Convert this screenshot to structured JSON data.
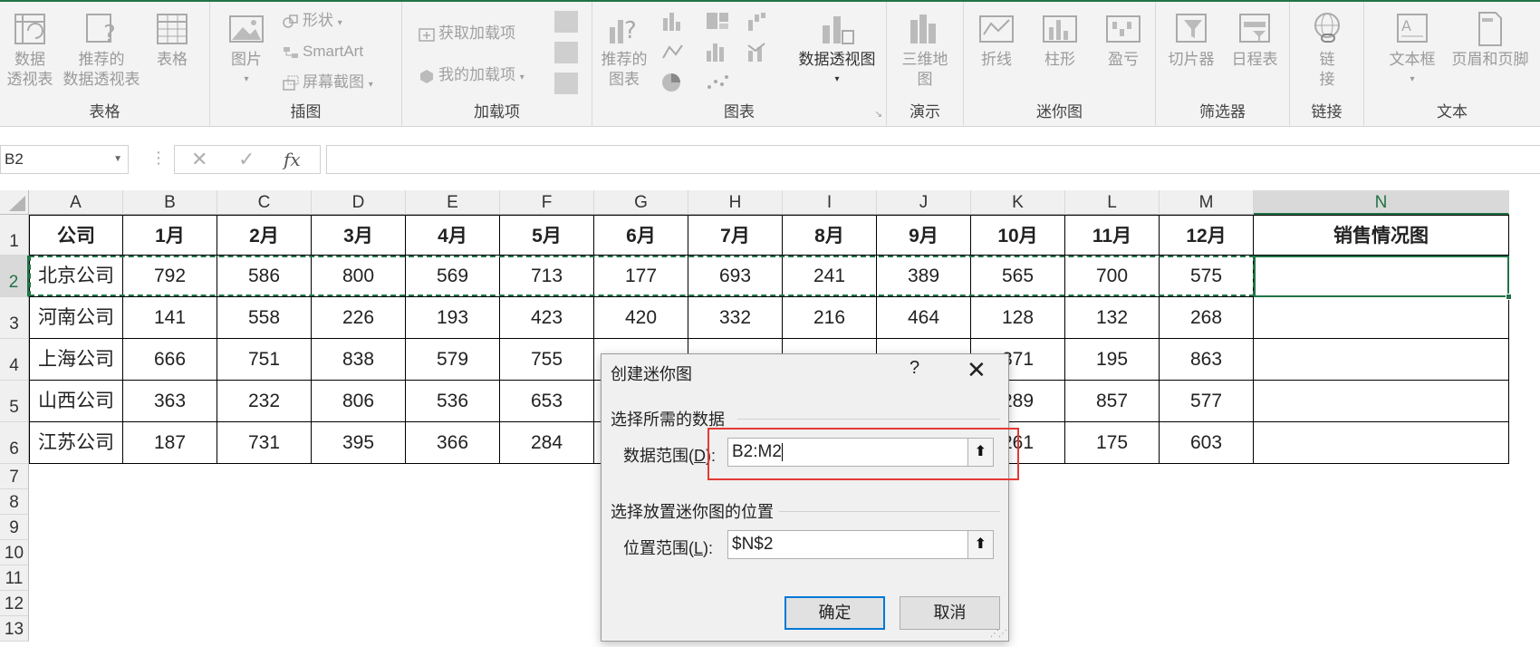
{
  "ribbon": {
    "groups": [
      {
        "label": "表格",
        "buttons": [
          "数据\n透视表",
          "推荐的\n数据透视表",
          "表格"
        ]
      },
      {
        "label": "插图",
        "big": "图片",
        "small": [
          "形状",
          "SmartArt",
          "屏幕截图"
        ]
      },
      {
        "label": "加载项",
        "small": [
          "获取加载项",
          "我的加载项"
        ]
      },
      {
        "label": "图表",
        "big": "推荐的\n图表",
        "pivot": "数据透视图"
      },
      {
        "label": "演示",
        "big": "三维地\n图"
      },
      {
        "label": "迷你图",
        "buttons": [
          "折线",
          "柱形",
          "盈亏"
        ]
      },
      {
        "label": "筛选器",
        "buttons": [
          "切片器",
          "日程表"
        ]
      },
      {
        "label": "链接",
        "big": "链\n接"
      },
      {
        "label": "文本",
        "buttons": [
          "文本框",
          "页眉和页脚"
        ]
      }
    ]
  },
  "formula_bar": {
    "name_box": "B2",
    "cancel_icon": "✕",
    "enter_icon": "✓",
    "fx_label": "fx",
    "formula": ""
  },
  "sheet": {
    "columns": [
      "A",
      "B",
      "C",
      "D",
      "E",
      "F",
      "G",
      "H",
      "I",
      "J",
      "K",
      "L",
      "M",
      "N"
    ],
    "selected_column": "N",
    "rows": [
      "1",
      "2",
      "3",
      "4",
      "5",
      "6",
      "7",
      "8",
      "9",
      "10",
      "11",
      "12",
      "13"
    ],
    "selected_row": "2",
    "header": [
      "公司",
      "1月",
      "2月",
      "3月",
      "4月",
      "5月",
      "6月",
      "7月",
      "8月",
      "9月",
      "10月",
      "11月",
      "12月",
      "销售情况图"
    ],
    "data": [
      [
        "北京公司",
        "792",
        "586",
        "800",
        "569",
        "713",
        "177",
        "693",
        "241",
        "389",
        "565",
        "700",
        "575",
        ""
      ],
      [
        "河南公司",
        "141",
        "558",
        "226",
        "193",
        "423",
        "420",
        "332",
        "216",
        "464",
        "128",
        "132",
        "268",
        ""
      ],
      [
        "上海公司",
        "666",
        "751",
        "838",
        "579",
        "755",
        "",
        "",
        "",
        "",
        "371",
        "195",
        "863",
        ""
      ],
      [
        "山西公司",
        "363",
        "232",
        "806",
        "536",
        "653",
        "",
        "",
        "",
        "",
        "289",
        "857",
        "577",
        ""
      ],
      [
        "江苏公司",
        "187",
        "731",
        "395",
        "366",
        "284",
        "",
        "",
        "",
        "",
        "261",
        "175",
        "603",
        ""
      ]
    ]
  },
  "dialog": {
    "title": "创建迷你图",
    "help": "?",
    "close": "✕",
    "section1": "选择所需的数据",
    "data_range_label": "数据范围(",
    "data_range_key": "D",
    "data_range_suffix": "):",
    "data_range_value": "B2:M2",
    "section2": "选择放置迷你图的位置",
    "location_label": "位置范围(",
    "location_key": "L",
    "location_suffix": "):",
    "location_value": "$N$2",
    "collapse_icon": "⬆",
    "ok": "确定",
    "cancel": "取消"
  },
  "colors": {
    "excel_green": "#217346",
    "highlight_red": "#e53935",
    "dialog_bg": "#f0f0f0",
    "primary_border": "#0078d7"
  }
}
